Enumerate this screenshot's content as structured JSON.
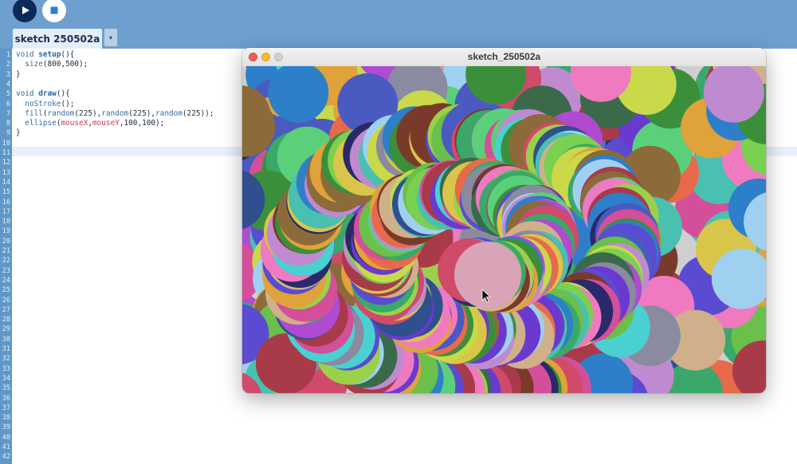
{
  "toolbar": {
    "run_icon": "play-icon",
    "stop_icon": "stop-icon",
    "run_color": "#0b2a5a",
    "background": "#6f9fcf"
  },
  "tabs": {
    "active_label": "sketch 250502a",
    "menu_glyph": "▾"
  },
  "editor": {
    "line_count": 42,
    "current_line": 11,
    "lines": [
      {
        "n": "1",
        "parts": [
          [
            "kw",
            "void "
          ],
          [
            "fn",
            "setup"
          ],
          [
            "",
            "(){"
          ]
        ]
      },
      {
        "n": "2",
        "parts": [
          [
            "",
            "  "
          ],
          [
            "call",
            "size"
          ],
          [
            "",
            "(800,500);"
          ]
        ]
      },
      {
        "n": "3",
        "parts": [
          [
            "",
            "}"
          ]
        ]
      },
      {
        "n": "4",
        "parts": []
      },
      {
        "n": "5",
        "parts": [
          [
            "kw",
            "void "
          ],
          [
            "fn",
            "draw"
          ],
          [
            "",
            "(){"
          ]
        ]
      },
      {
        "n": "6",
        "parts": [
          [
            "",
            "  "
          ],
          [
            "call",
            "noStroke"
          ],
          [
            "",
            "();"
          ]
        ]
      },
      {
        "n": "7",
        "parts": [
          [
            "",
            "  "
          ],
          [
            "call",
            "fill"
          ],
          [
            "",
            "("
          ],
          [
            "call",
            "random"
          ],
          [
            "",
            "(225),"
          ],
          [
            "call",
            "random"
          ],
          [
            "",
            "(225),"
          ],
          [
            "call",
            "random"
          ],
          [
            "",
            "(225));"
          ]
        ]
      },
      {
        "n": "8",
        "parts": [
          [
            "",
            "  "
          ],
          [
            "call",
            "ellipse"
          ],
          [
            "",
            "("
          ],
          [
            "var",
            "mouseX"
          ],
          [
            "",
            ","
          ],
          [
            "var",
            "mouseY"
          ],
          [
            "",
            ",100,100);"
          ]
        ]
      },
      {
        "n": "9",
        "parts": [
          [
            "",
            "}"
          ]
        ]
      },
      {
        "n": "10",
        "parts": []
      },
      {
        "n": "11",
        "parts": []
      }
    ]
  },
  "sketch_window": {
    "title": "sketch_250502a",
    "traffic_colors": {
      "close": "#f25f57",
      "minimize": "#f8bc2e",
      "maximize": "#d0d0d0"
    },
    "cursor_icon": "arrow-cursor-icon",
    "palette": [
      "#5a4bd0",
      "#7ad04f",
      "#d44f9a",
      "#3c8f3a",
      "#e0a23a",
      "#2d7fc9",
      "#a83a4a",
      "#4ac0b0",
      "#8c6a3a",
      "#c9d94a",
      "#6a3ad0",
      "#e76a4a",
      "#3aa86a",
      "#b04ad0",
      "#4a5ac0",
      "#d9c54a",
      "#2f4f8f",
      "#9ad04a",
      "#d04a6a",
      "#5ad07a",
      "#8a8aa0",
      "#c08ad0",
      "#4ad0d0",
      "#7a3a2a",
      "#d0b08a",
      "#3a6a4a",
      "#f07ac0",
      "#6ac04a",
      "#2a2a6a",
      "#a0d0f0"
    ]
  }
}
